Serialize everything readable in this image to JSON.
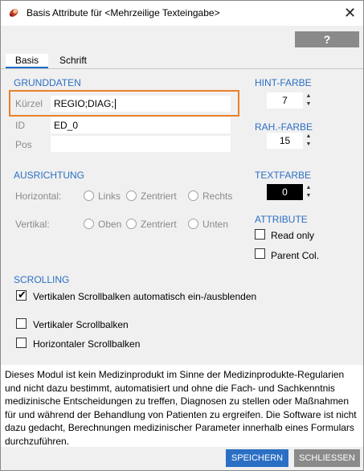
{
  "window": {
    "title": "Basis Attribute für <Mehrzeilige Texteingabe>",
    "close_glyph": "✕"
  },
  "toolbar": {
    "help_label": "?"
  },
  "tabs": [
    {
      "label": "Basis",
      "active": true
    },
    {
      "label": "Schrift",
      "active": false
    }
  ],
  "grunddaten": {
    "heading": "GRUNDDATEN",
    "kuerzel_label": "Kürzel",
    "kuerzel_value": "REGIO;DIAG;",
    "id_label": "ID",
    "id_value": "ED_0",
    "pos_label": "Pos",
    "pos_value": ""
  },
  "ausrichtung": {
    "heading": "AUSRICHTUNG",
    "horizontal_label": "Horizontal:",
    "horizontal_options": [
      "Links",
      "Zentriert",
      "Rechts"
    ],
    "vertikal_label": "Vertikal:",
    "vertikal_options": [
      "Oben",
      "Zentriert",
      "Unten"
    ]
  },
  "hint_farbe": {
    "heading": "HINT-FARBE",
    "value": "7"
  },
  "rah_farbe": {
    "heading": "RAH.-FARBE",
    "value": "15"
  },
  "textfarbe": {
    "heading": "TEXTFARBE",
    "value": "0"
  },
  "attribute": {
    "heading": "ATTRIBUTE",
    "read_only_label": "Read only",
    "read_only_checked": false,
    "parent_col_label": "Parent Col.",
    "parent_col_checked": false
  },
  "scrolling": {
    "heading": "SCROLLING",
    "auto_label": "Vertikalen Scrollbalken automatisch ein-/ausblenden",
    "auto_checked": true,
    "vertical_label": "Vertikaler Scrollbalken",
    "vertical_checked": false,
    "horizontal_label": "Horizontaler Scrollbalken",
    "horizontal_checked": false
  },
  "notice": {
    "lines": [
      "Dieses Modul ist kein Medizinprodukt im Sinne der Medizinprodukte-Regularien",
      "und nicht dazu bestimmt, automatisiert und ohne die Fach- und Sachkenntnis",
      "medizinische Entscheidungen zu treffen, Diagnosen zu stellen oder Maßnahmen",
      "für und während der Behandlung von Patienten zu ergreifen. Die Software ist nicht",
      "dazu gedacht, Berechnungen medizinischer Parameter innerhalb eines Formulars",
      "durchzuführen."
    ]
  },
  "footer": {
    "save_label": "SPEICHERN",
    "close_label": "SCHLIESSEN"
  },
  "colors": {
    "accent": "#2b6fc4",
    "highlight": "#e8822a",
    "gray_button": "#8a8a8a"
  },
  "icons": {
    "app": "pill-capsule-icon",
    "spin_up": "▲",
    "spin_down": "▼",
    "check": "✔"
  }
}
